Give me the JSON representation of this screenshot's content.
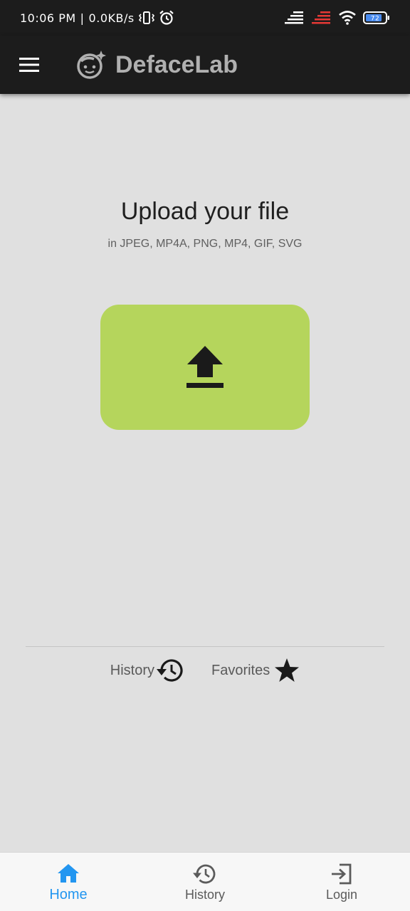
{
  "status_bar": {
    "time": "10:06 PM",
    "separator": "|",
    "network_speed": "0.0KB/s",
    "battery_level": "72"
  },
  "app_bar": {
    "title": "DefaceLab",
    "title_color": "#b0b0b0",
    "logo_icon": "face-smile-sparkle-icon",
    "menu_icon": "hamburger-menu-icon"
  },
  "upload": {
    "title": "Upload your file",
    "formats": "in JPEG, MP4A, PNG, MP4, GIF, SVG",
    "button_icon": "upload-icon",
    "button_color": "#b5d55c"
  },
  "quick_links": [
    {
      "label": "History",
      "icon": "history-icon"
    },
    {
      "label": "Favorites",
      "icon": "star-icon"
    }
  ],
  "bottom_nav": {
    "active_color": "#2396f0",
    "items": [
      {
        "label": "Home",
        "icon": "home-icon",
        "active": true
      },
      {
        "label": "History",
        "icon": "history-icon",
        "active": false
      },
      {
        "label": "Login",
        "icon": "login-icon",
        "active": false
      }
    ]
  }
}
